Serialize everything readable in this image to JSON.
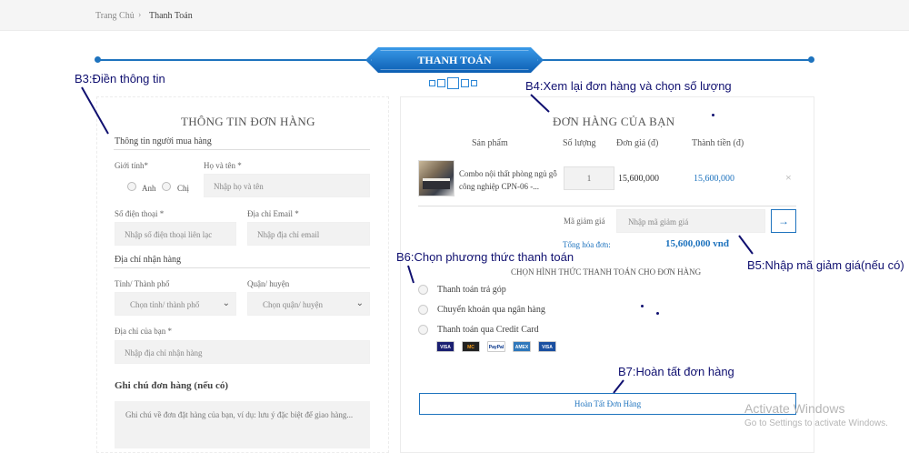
{
  "breadcrumb": {
    "home": "Trang Chủ",
    "separator": "›",
    "current": "Thanh Toán"
  },
  "page_title": "THANH TOÁN",
  "order_info": {
    "heading": "THÔNG TIN ĐƠN HÀNG",
    "buyer_section": "Thông tin người mua hàng",
    "gender_label": "Giới tính*",
    "gender_options": [
      "Anh",
      "Chị"
    ],
    "name_label": "Họ và tên *",
    "name_placeholder": "Nhập họ và tên",
    "phone_label": "Số điện thoại *",
    "phone_placeholder": "Nhập số điện thoại liên lạc",
    "email_label": "Địa chỉ Email *",
    "email_placeholder": "Nhập địa chỉ email",
    "address_section": "Địa chỉ nhận hàng",
    "province_label": "Tỉnh/ Thành phố",
    "province_value": "Chọn tỉnh/ thành phố",
    "district_label": "Quận/ huyện",
    "district_value": "Chọn quận/ huyện",
    "address_label": "Địa chỉ của bạn *",
    "address_placeholder": "Nhập địa chỉ nhận hàng",
    "notes_title": "Ghi chú đơn hàng (nếu có)",
    "notes_placeholder": "Ghi chú về đơn đặt hàng của bạn, ví dụ: lưu ý đặc biệt để giao hàng..."
  },
  "cart": {
    "heading": "ĐƠN HÀNG CỦA BẠN",
    "columns": [
      "Sản phẩm",
      "Số lượng",
      "Đơn giá (đ)",
      "Thành tiền (đ)"
    ],
    "item": {
      "name": "Combo nội thất phòng ngủ gỗ công nghiệp CPN-06 -...",
      "quantity": "1",
      "unit_price": "15,600,000",
      "subtotal": "15,600,000",
      "remove": "×"
    },
    "promo_label": "Mã giảm giá",
    "promo_placeholder": "Nhập mã giảm giá",
    "promo_button": "→",
    "total_label": "Tổng hóa đơn:",
    "total_value": "15,600,000 vnđ"
  },
  "payment": {
    "heading": "CHỌN HÌNH THỨC THANH TOÁN CHO ĐƠN HÀNG",
    "options": [
      "Thanh toán trả góp",
      "Chuyển khoản qua ngân hàng",
      "Thanh toán qua Credit Card"
    ],
    "cards": [
      {
        "name": "visa-card-icon",
        "text": "VISA",
        "bg": "#1a1f71",
        "fg": "#ffffff"
      },
      {
        "name": "mastercard-icon",
        "text": "MC",
        "bg": "#222222",
        "fg": "#f79e1b"
      },
      {
        "name": "paypal-icon",
        "text": "PayPal",
        "bg": "#ffffff",
        "fg": "#003087"
      },
      {
        "name": "amex-icon",
        "text": "AMEX",
        "bg": "#2e77bb",
        "fg": "#ffffff"
      },
      {
        "name": "visa-electron-icon",
        "text": "VISA",
        "bg": "#1a4fa0",
        "fg": "#ffffff"
      }
    ],
    "submit": "Hoàn Tất Đơn Hàng"
  },
  "annotations": {
    "b3": "B3:Điền thông tin",
    "b4": "B4:Xem lại đơn hàng và chọn số lượng",
    "b5": "B5:Nhập mã giảm giá(nếu có)",
    "b6": "B6:Chọn phương thức thanh toán",
    "b7": "B7:Hoàn tất đơn hàng"
  },
  "watermark": {
    "line1": "Activate Windows",
    "line2": "Go to Settings to activate Windows."
  },
  "colors": {
    "accent": "#1e73be",
    "annotation": "#101070",
    "field_bg": "#f2f2f2"
  }
}
